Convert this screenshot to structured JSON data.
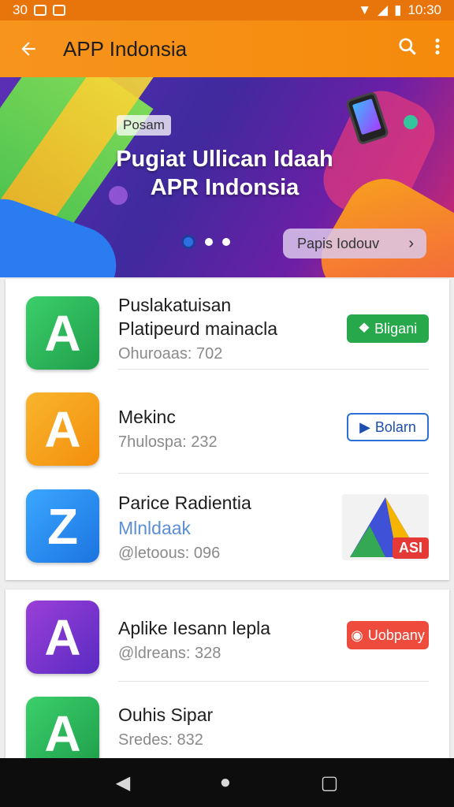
{
  "status_bar": {
    "left_text": "30",
    "time": "10:30"
  },
  "app_bar": {
    "title": "APP Indonsia"
  },
  "banner": {
    "badge": "Posam",
    "title_line1": "Pugiat Ullican Idaah",
    "title_line2": "APR Indonsia",
    "button_label": "Papis Iodouv",
    "pages": 3,
    "active_page": 1
  },
  "apps": [
    {
      "name_line1": "Puslakatuisan",
      "name_line2": "Platipeurd mainacla",
      "sub": "Ohuroaas: 702",
      "action": "Bligani",
      "action_color": "#27a84a",
      "icon_color": "#2fb457",
      "icon_glyph": "A"
    },
    {
      "name_line1": "Mekinc",
      "name_line2": "",
      "sub": "7hulospa: 232",
      "action": "Bolarn",
      "action_color": "#ffffff",
      "icon_color": "#f5a31b",
      "icon_glyph": "A"
    },
    {
      "name_line1": "Parice Radientia",
      "name_line2": "Mlnldaak",
      "sub": "@letoous: 096",
      "action": "ASI",
      "action_color": "#e53935",
      "icon_color": "#2a8ef2",
      "icon_glyph": "Z"
    }
  ],
  "apps2": [
    {
      "name_line1": "Aplike Iesann lepla",
      "sub": "@ldreans: 328",
      "action": "Uobpany",
      "action_color": "#ef4b3c",
      "icon_color": "#7b3fd6",
      "icon_glyph": "A"
    },
    {
      "name_line1": "Ouhis Sipar",
      "sub": "Sredes: 832",
      "icon_color": "#2fb457",
      "icon_glyph": "A"
    }
  ]
}
